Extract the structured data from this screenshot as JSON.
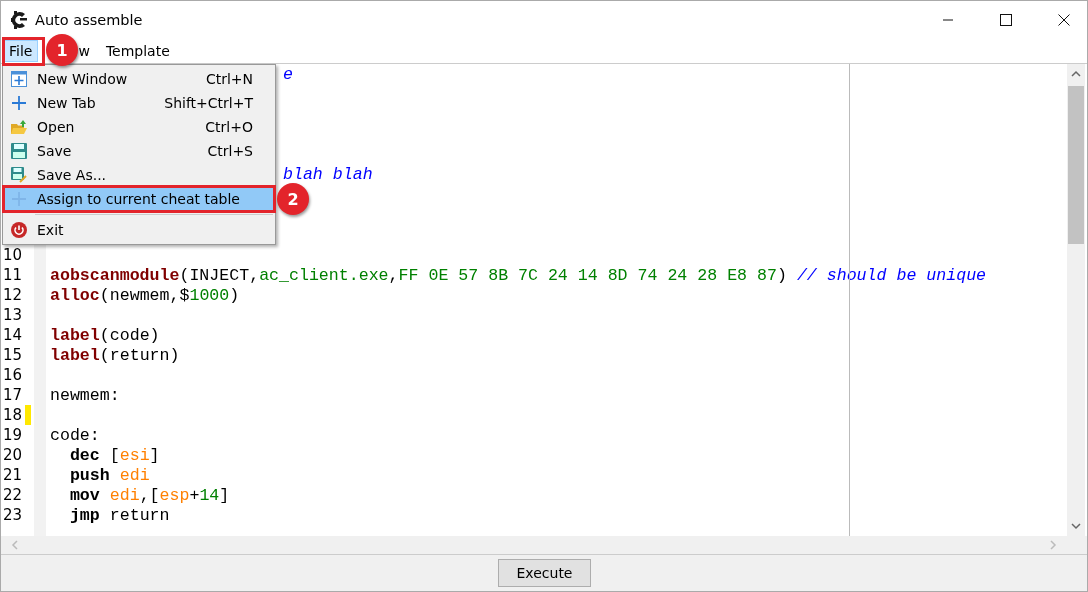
{
  "window": {
    "title": "Auto assemble"
  },
  "menubar": [
    {
      "label": "File",
      "selected": true
    },
    {
      "label": "w",
      "selected": false
    }
  ],
  "menubar_extra": {
    "label": "Template"
  },
  "file_menu": [
    {
      "kind": "item",
      "label": "New Window",
      "shortcut": "Ctrl+N",
      "selected": false
    },
    {
      "kind": "item",
      "label": "New Tab",
      "shortcut": "Shift+Ctrl+T",
      "selected": false
    },
    {
      "kind": "item",
      "label": "Open",
      "shortcut": "Ctrl+O",
      "selected": false
    },
    {
      "kind": "item",
      "label": "Save",
      "shortcut": "Ctrl+S",
      "selected": false
    },
    {
      "kind": "item",
      "label": "Save As...",
      "selected": false
    },
    {
      "kind": "item",
      "label": "Assign to current cheat table",
      "selected": true
    },
    {
      "kind": "separator"
    },
    {
      "kind": "item",
      "label": "Exit",
      "selected": false
    }
  ],
  "annotations": [
    {
      "label": "1"
    },
    {
      "label": "2"
    }
  ],
  "editor": {
    "fragments": [
      {
        "kind": "comment",
        "text": "e"
      },
      {
        "kind": "comment",
        "text": "blah blah"
      }
    ],
    "lines": [
      {
        "number": "10",
        "marked": false
      },
      {
        "number": "11",
        "marked": false,
        "segments": [
          {
            "kind": "keyword",
            "text": "aobscanmodule"
          },
          {
            "kind": "plain",
            "text": "(INJECT,"
          },
          {
            "kind": "string",
            "text": "ac_client.exe"
          },
          {
            "kind": "plain",
            "text": ","
          },
          {
            "kind": "number",
            "text": "FF 0E 57 8B 7C 24 14 8D 74 24 28 E8 87"
          },
          {
            "kind": "plain",
            "text": ") "
          },
          {
            "kind": "comment",
            "text": "// should be unique"
          }
        ]
      },
      {
        "number": "12",
        "marked": false,
        "segments": [
          {
            "kind": "keyword",
            "text": "alloc"
          },
          {
            "kind": "plain",
            "text": "(newmem,$"
          },
          {
            "kind": "number",
            "text": "1000"
          },
          {
            "kind": "plain",
            "text": ")"
          }
        ]
      },
      {
        "number": "13",
        "marked": false
      },
      {
        "number": "14",
        "marked": false,
        "segments": [
          {
            "kind": "keyword",
            "text": "label"
          },
          {
            "kind": "plain",
            "text": "(code)"
          }
        ]
      },
      {
        "number": "15",
        "marked": false,
        "segments": [
          {
            "kind": "keyword",
            "text": "label"
          },
          {
            "kind": "plain",
            "text": "(return)"
          }
        ]
      },
      {
        "number": "16",
        "marked": false
      },
      {
        "number": "17",
        "marked": false,
        "segments": [
          {
            "kind": "plain",
            "text": "newmem:"
          }
        ]
      },
      {
        "number": "18",
        "marked": true
      },
      {
        "number": "19",
        "marked": false,
        "segments": [
          {
            "kind": "plain",
            "text": "code:"
          }
        ]
      },
      {
        "number": "20",
        "marked": false,
        "segments": [
          {
            "kind": "instruction",
            "text": "  dec"
          },
          {
            "kind": "plain",
            "text": " ["
          },
          {
            "kind": "register",
            "text": "esi"
          },
          {
            "kind": "plain",
            "text": "]"
          }
        ]
      },
      {
        "number": "21",
        "marked": false,
        "segments": [
          {
            "kind": "instruction",
            "text": "  push "
          },
          {
            "kind": "register",
            "text": "edi"
          }
        ]
      },
      {
        "number": "22",
        "marked": false,
        "segments": [
          {
            "kind": "instruction",
            "text": "  mov "
          },
          {
            "kind": "register",
            "text": "edi"
          },
          {
            "kind": "plain",
            "text": ",["
          },
          {
            "kind": "register",
            "text": "esp"
          },
          {
            "kind": "plain",
            "text": "+"
          },
          {
            "kind": "number",
            "text": "14"
          },
          {
            "kind": "plain",
            "text": "]"
          }
        ]
      },
      {
        "number": "23",
        "marked": false,
        "segments": [
          {
            "kind": "instruction",
            "text": "  jmp"
          },
          {
            "kind": "plain",
            "text": " return"
          }
        ]
      }
    ]
  },
  "execute_button": {
    "label": "Execute"
  }
}
